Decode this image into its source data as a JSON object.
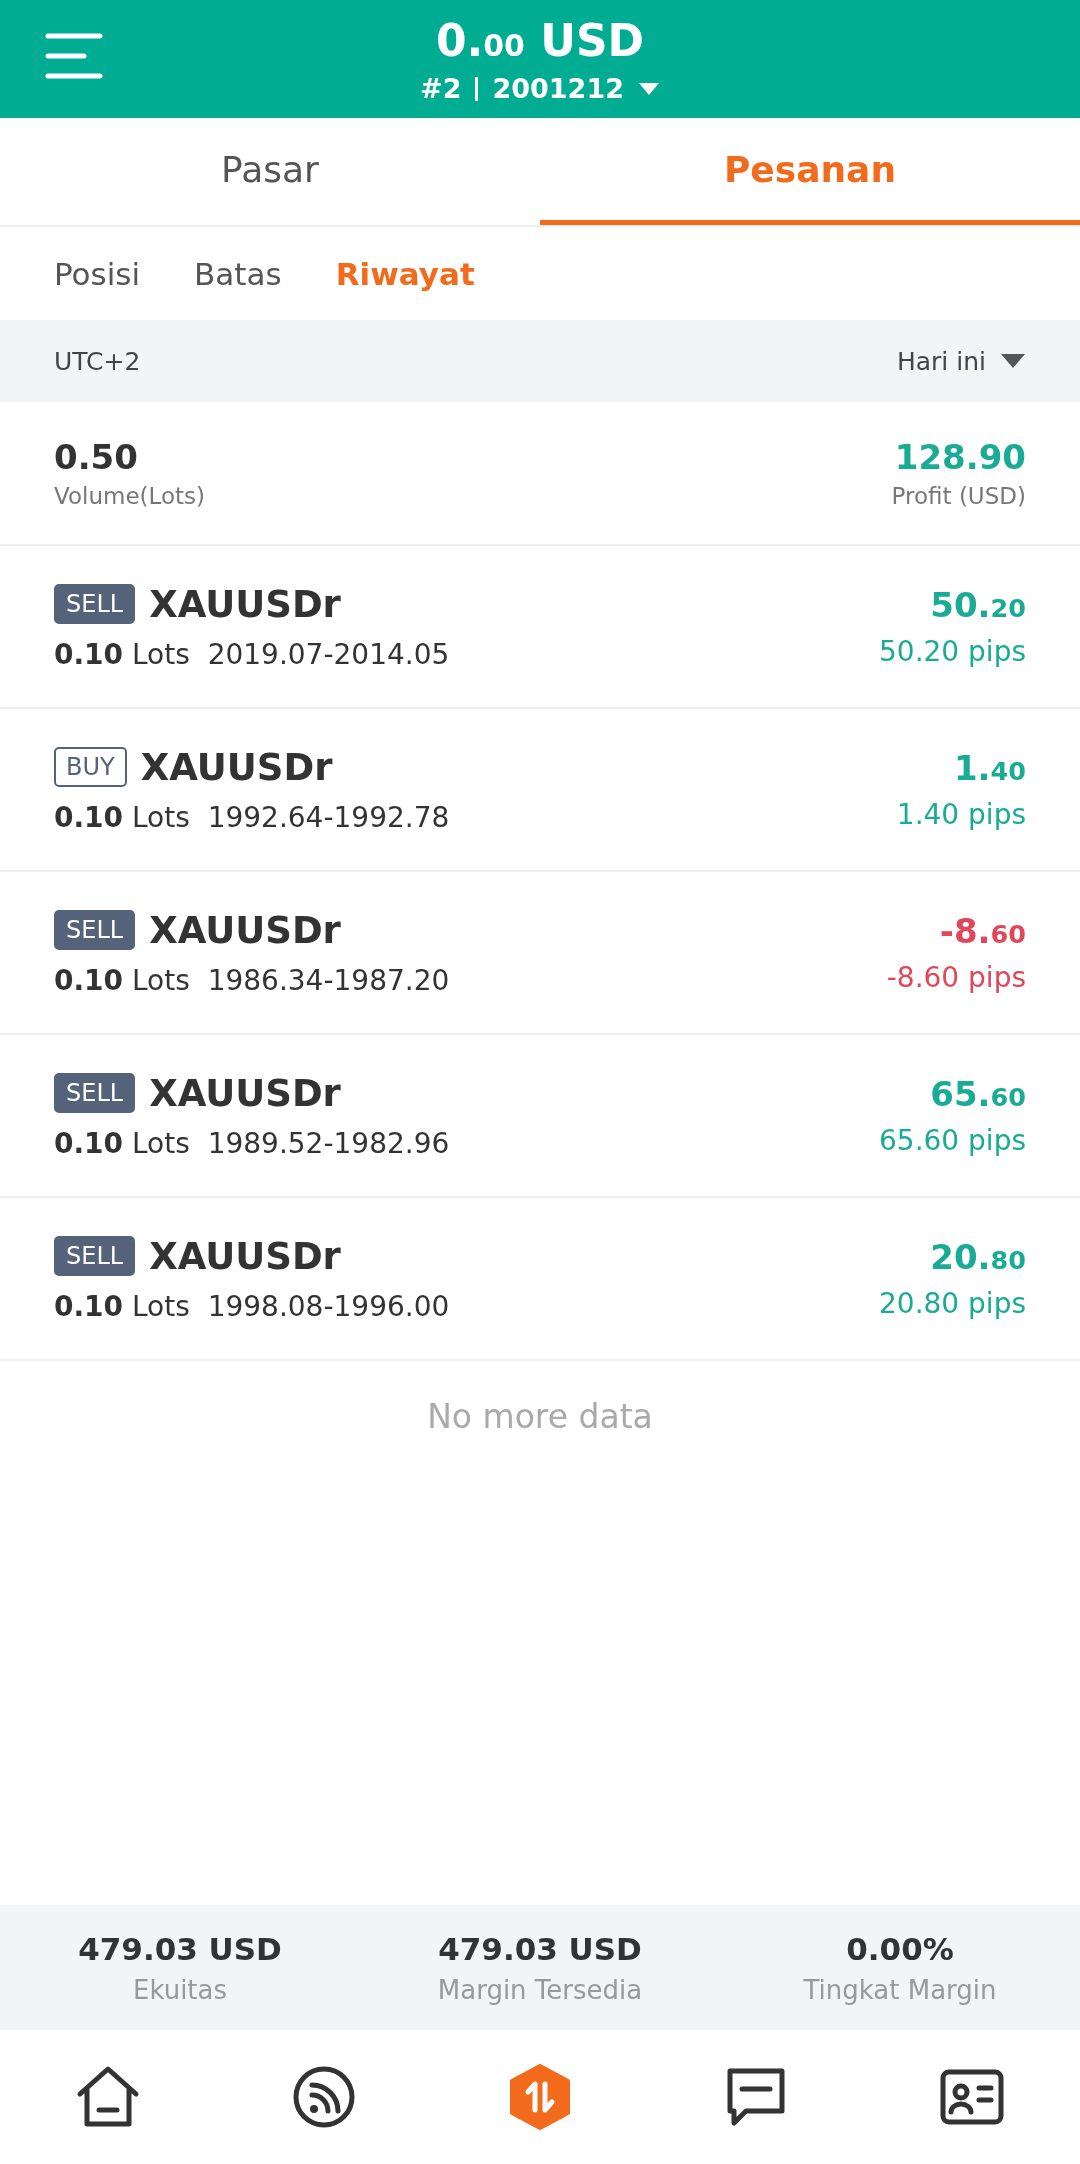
{
  "header": {
    "balance": "0.00 USD",
    "account": "#2",
    "account_id": "2001212"
  },
  "tabs": [
    {
      "label": "Pasar",
      "selected": false
    },
    {
      "label": "Pesanan",
      "selected": true
    }
  ],
  "subtabs": [
    {
      "label": "Posisi",
      "selected": false
    },
    {
      "label": "Batas",
      "selected": false
    },
    {
      "label": "Riwayat",
      "selected": true
    }
  ],
  "filter": {
    "timezone": "UTC+2",
    "period": "Hari ini"
  },
  "summary": {
    "volume": "0.50",
    "volume_label": "Volume(Lots)",
    "profit": "128.90",
    "profit_label": "Profit (USD)"
  },
  "trades": [
    {
      "kind": "sell",
      "side": "SELL",
      "symbol": "XAUUSDr",
      "lots": "0.10",
      "lots_unit": "Lots",
      "prices": "2019.07-2014.05",
      "profit": "50.20",
      "pips": "50.20 pips",
      "color": "#1aab95"
    },
    {
      "kind": "buy",
      "side": "BUY",
      "symbol": "XAUUSDr",
      "lots": "0.10",
      "lots_unit": "Lots",
      "prices": "1992.64-1992.78",
      "profit": "1.40",
      "pips": "1.40 pips",
      "color": "#1aab95"
    },
    {
      "kind": "sell",
      "side": "SELL",
      "symbol": "XAUUSDr",
      "lots": "0.10",
      "lots_unit": "Lots",
      "prices": "1986.34-1987.20",
      "profit": "-8.60",
      "pips": "-8.60 pips",
      "color": "#e0475a"
    },
    {
      "kind": "sell",
      "side": "SELL",
      "symbol": "XAUUSDr",
      "lots": "0.10",
      "lots_unit": "Lots",
      "prices": "1989.52-1982.96",
      "profit": "65.60",
      "pips": "65.60 pips",
      "color": "#1aab95"
    },
    {
      "kind": "sell",
      "side": "SELL",
      "symbol": "XAUUSDr",
      "lots": "0.10",
      "lots_unit": "Lots",
      "prices": "1998.08-1996.00",
      "profit": "20.80",
      "pips": "20.80 pips",
      "color": "#1aab95"
    }
  ],
  "end_note": "No more data",
  "account_stats": [
    {
      "value": "479.03 USD",
      "label": "Ekuitas"
    },
    {
      "value": "479.03 USD",
      "label": "Margin Tersedia"
    },
    {
      "value": "0.00%",
      "label": "Tingkat Margin"
    }
  ],
  "nav": [
    {
      "kind": "home",
      "selected": false
    },
    {
      "kind": "feed",
      "selected": false
    },
    {
      "kind": "trade",
      "selected": true
    },
    {
      "kind": "chat",
      "selected": false
    },
    {
      "kind": "profile",
      "selected": false
    }
  ]
}
